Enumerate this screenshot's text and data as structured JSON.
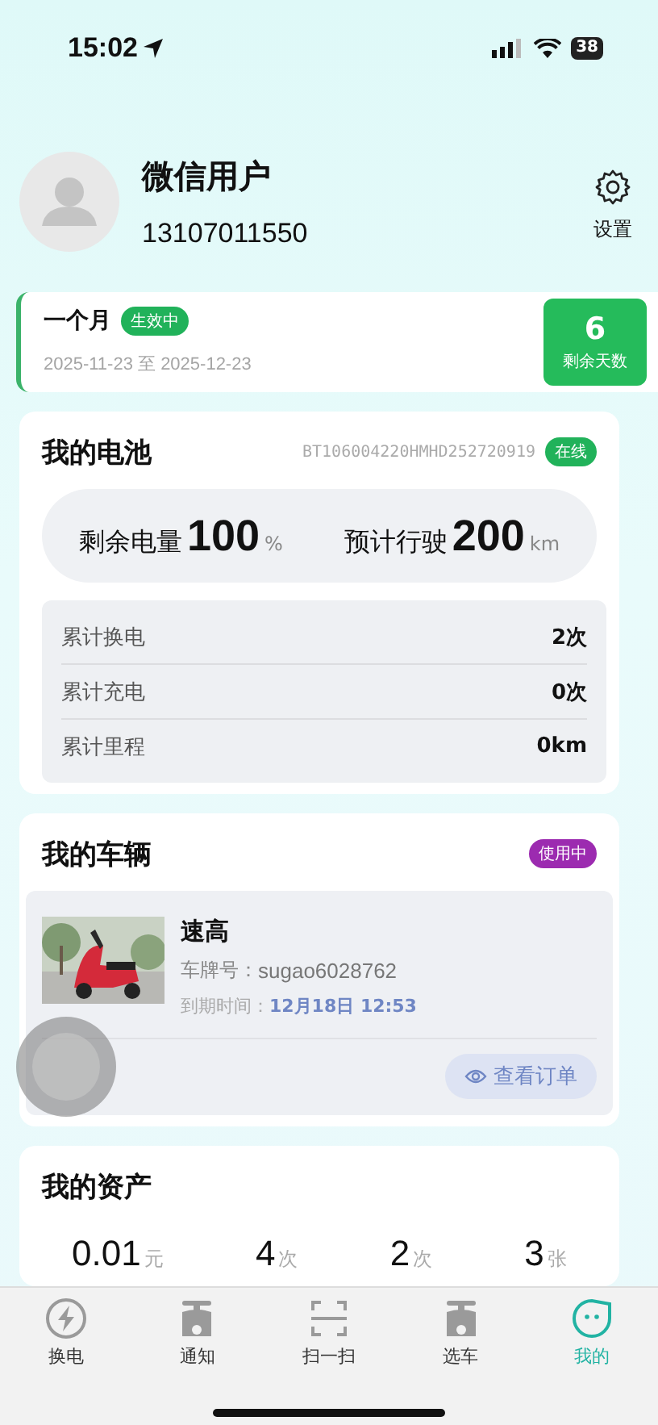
{
  "status_bar": {
    "time": "15:02",
    "battery": "38"
  },
  "profile": {
    "name": "微信用户",
    "phone": "13107011550",
    "settings_label": "设置"
  },
  "plan": {
    "title": "一个月",
    "badge": "生效中",
    "dates": "2025-11-23 至 2025-12-23",
    "days": "6",
    "days_label": "剩余天数"
  },
  "battery": {
    "title": "我的电池",
    "serial": "BT106004220HMHD252720919",
    "status": "在线",
    "charge_label": "剩余电量",
    "charge": "100",
    "charge_unit": "%",
    "range_label": "预计行驶",
    "range": "200",
    "range_unit": "km",
    "stats": [
      {
        "label": "累计换电",
        "value": "2次"
      },
      {
        "label": "累计充电",
        "value": "0次"
      },
      {
        "label": "累计里程",
        "value": "0km"
      }
    ]
  },
  "vehicle": {
    "title": "我的车辆",
    "status": "使用中",
    "name": "速高",
    "plate_label": "车牌号：",
    "plate": "sugao6028762",
    "expiry_label": "到期时间：",
    "expiry": "12月18日 12:53",
    "button": "查看订单"
  },
  "assets": {
    "title": "我的资产",
    "items": [
      {
        "value": "0.01",
        "unit": "元"
      },
      {
        "value": "4",
        "unit": "次"
      },
      {
        "value": "2",
        "unit": "次"
      },
      {
        "value": "3",
        "unit": "张"
      }
    ]
  },
  "tab_bar": [
    {
      "label": "换电",
      "kind": "bolt",
      "selected": false
    },
    {
      "label": "通知",
      "kind": "scooter",
      "selected": false
    },
    {
      "label": "扫一扫",
      "kind": "scan",
      "selected": false
    },
    {
      "label": "选车",
      "kind": "scooter",
      "selected": false
    },
    {
      "label": "我的",
      "kind": "face",
      "selected": true
    }
  ]
}
